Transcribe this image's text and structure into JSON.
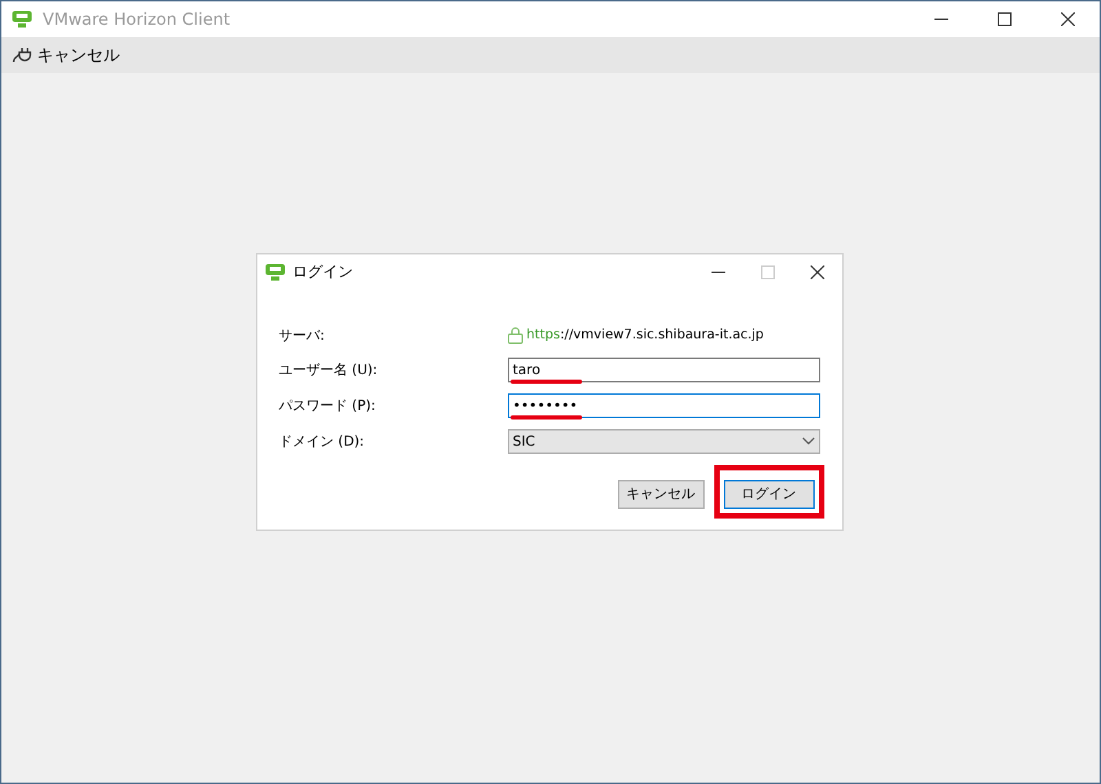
{
  "window": {
    "title": "VMware Horizon Client"
  },
  "toolbar": {
    "cancel_label": "キャンセル"
  },
  "dialog": {
    "title": "ログイン",
    "server": {
      "label": "サーバ:",
      "url_scheme": "https",
      "url_rest": "://vmview7.sic.shibaura-it.ac.jp"
    },
    "fields": [
      {
        "kind": "text",
        "label": "ユーザー名 (U):",
        "value": "taro",
        "focused": false,
        "underlined": true
      },
      {
        "kind": "text",
        "label": "パスワード (P):",
        "value": "••••••••",
        "focused": true,
        "underlined": true
      },
      {
        "kind": "select",
        "label": "ドメイン (D):",
        "value": "SIC",
        "focused": false,
        "underlined": false
      }
    ],
    "buttons": [
      {
        "label": "キャンセル",
        "default": false,
        "highlighted": false
      },
      {
        "label": "ログイン",
        "default": true,
        "highlighted": true
      }
    ]
  }
}
